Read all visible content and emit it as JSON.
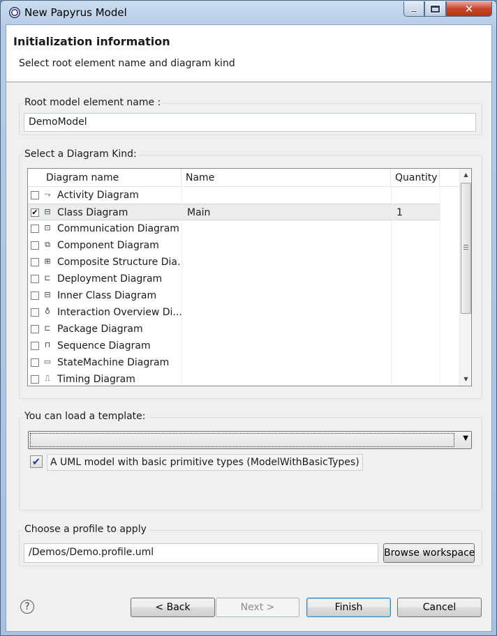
{
  "window": {
    "title": "New Papyrus Model"
  },
  "header": {
    "title": "Initialization information",
    "description": "Select root element name and diagram kind"
  },
  "root_name": {
    "label": "Root model element name :",
    "value": "DemoModel"
  },
  "diagram_kind": {
    "label": "Select a Diagram Kind:",
    "columns": [
      "Diagram name",
      "Name",
      "Quantity"
    ],
    "rows": [
      {
        "icon": "activity-diagram-icon",
        "glyph": "⤳",
        "diagram": "Activity Diagram",
        "name": "",
        "quantity": "",
        "checked": false
      },
      {
        "icon": "class-diagram-icon",
        "glyph": "⊟",
        "diagram": "Class Diagram",
        "name": "Main",
        "quantity": "1",
        "checked": true
      },
      {
        "icon": "communication-diagram-icon",
        "glyph": "⊡",
        "diagram": "Communication Diagram",
        "name": "",
        "quantity": "",
        "checked": false
      },
      {
        "icon": "component-diagram-icon",
        "glyph": "⧉",
        "diagram": "Component Diagram",
        "name": "",
        "quantity": "",
        "checked": false
      },
      {
        "icon": "composite-structure-diagram-icon",
        "glyph": "⊞",
        "diagram": "Composite Structure Dia...",
        "name": "",
        "quantity": "",
        "checked": false
      },
      {
        "icon": "deployment-diagram-icon",
        "glyph": "⊏",
        "diagram": "Deployment Diagram",
        "name": "",
        "quantity": "",
        "checked": false
      },
      {
        "icon": "inner-class-diagram-icon",
        "glyph": "⊟",
        "diagram": "Inner Class Diagram",
        "name": "",
        "quantity": "",
        "checked": false
      },
      {
        "icon": "interaction-overview-diagram-icon",
        "glyph": "♁",
        "diagram": "Interaction Overview Di...",
        "name": "",
        "quantity": "",
        "checked": false
      },
      {
        "icon": "package-diagram-icon",
        "glyph": "⊏",
        "diagram": "Package Diagram",
        "name": "",
        "quantity": "",
        "checked": false
      },
      {
        "icon": "sequence-diagram-icon",
        "glyph": "⊓",
        "diagram": "Sequence Diagram",
        "name": "",
        "quantity": "",
        "checked": false
      },
      {
        "icon": "state-machine-diagram-icon",
        "glyph": "▭",
        "diagram": "StateMachine Diagram",
        "name": "",
        "quantity": "",
        "checked": false
      },
      {
        "icon": "timing-diagram-icon",
        "glyph": "⎍",
        "diagram": "Timing Diagram",
        "name": "",
        "quantity": "",
        "checked": false
      }
    ]
  },
  "template": {
    "label": "You can load a template:",
    "selected": "",
    "option_label": "A UML model with basic primitive types (ModelWithBasicTypes)",
    "option_checked": true
  },
  "profile": {
    "label": "Choose a profile to apply",
    "value": "/Demos/Demo.profile.uml",
    "browse_label": "Browse workspace"
  },
  "buttons": {
    "help": "?",
    "back": "< Back",
    "next": "Next >",
    "finish": "Finish",
    "cancel": "Cancel"
  }
}
